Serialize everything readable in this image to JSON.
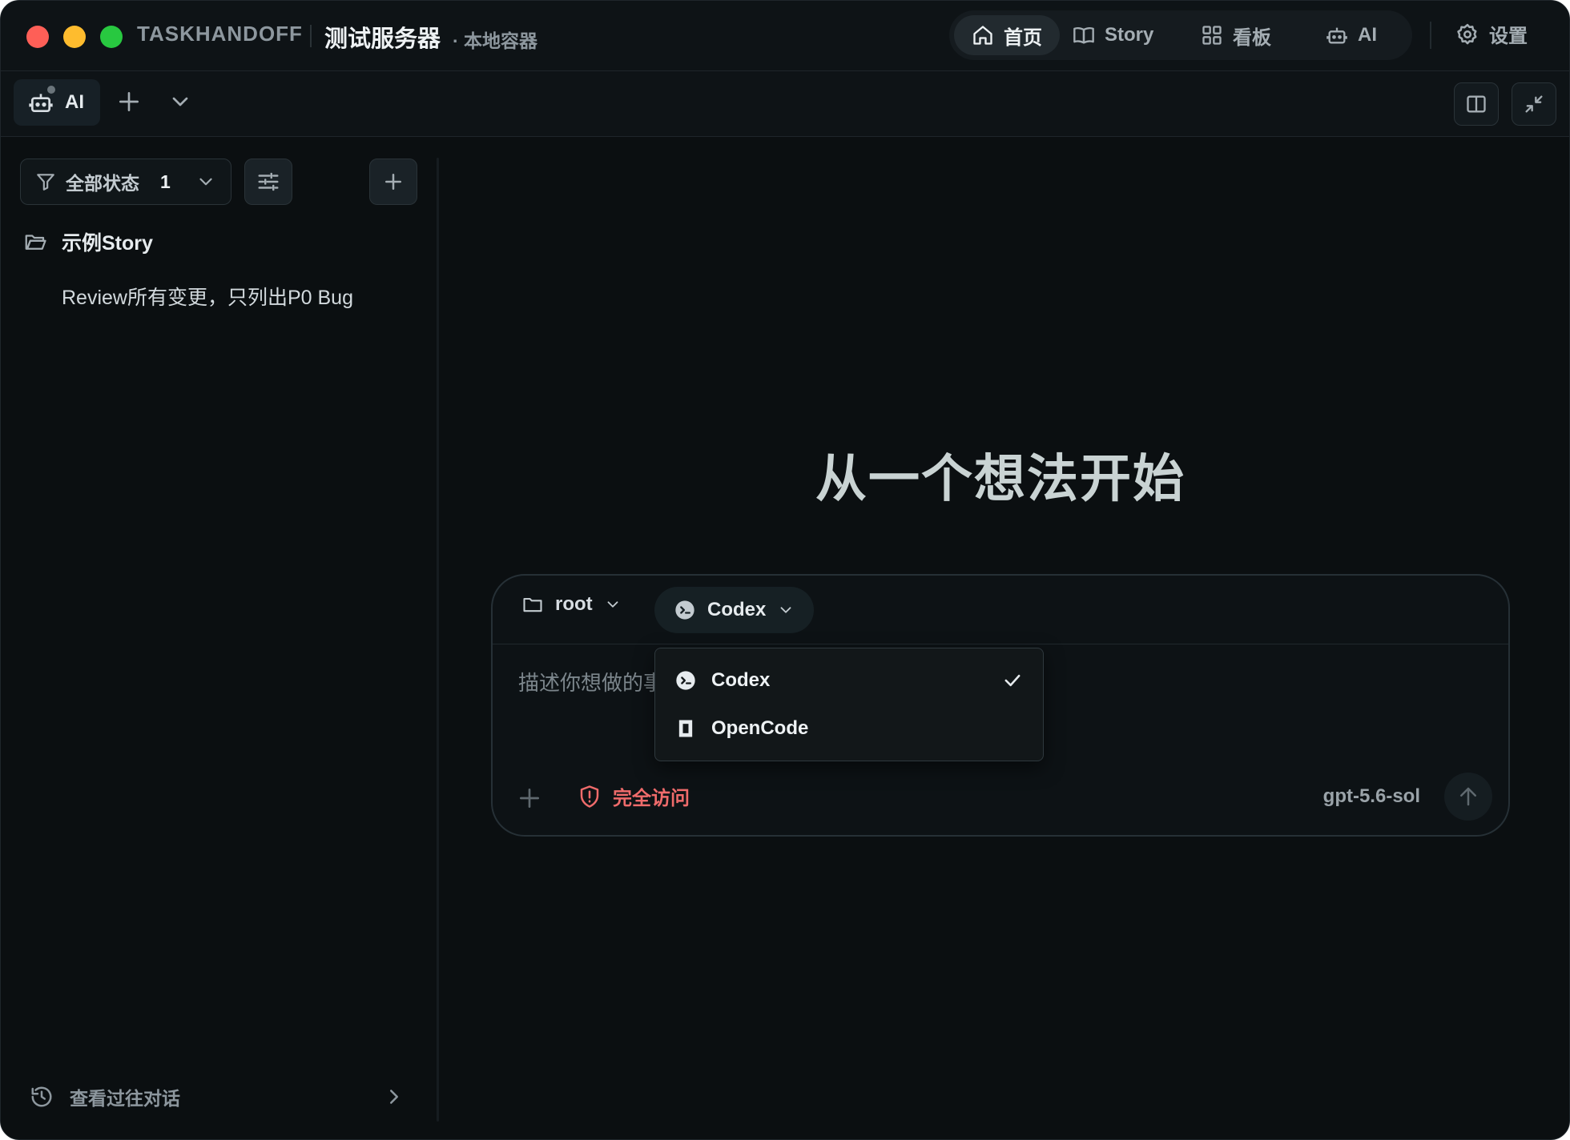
{
  "window": {
    "brand": "TASKHANDOFF",
    "server_name": "测试服务器",
    "server_sub": "· 本地容器"
  },
  "nav": {
    "items": [
      {
        "label": "首页",
        "icon": "home-icon",
        "active": true
      },
      {
        "label": "Story",
        "icon": "book-icon",
        "active": false
      },
      {
        "label": "看板",
        "icon": "grid-icon",
        "active": false
      },
      {
        "label": "AI",
        "icon": "robot-icon",
        "active": false
      }
    ],
    "settings_label": "设置"
  },
  "tabs": {
    "active_tab_label": "AI"
  },
  "sidebar": {
    "filter_label": "全部状态",
    "filter_count": "1",
    "story_group": "示例Story",
    "story_items": [
      "Review所有变更，只列出P0 Bug"
    ],
    "history_label": "查看过往对话"
  },
  "main": {
    "hero_title": "从一个想法开始",
    "composer": {
      "directory": "root",
      "agent": "Codex",
      "placeholder": "描述你想做的事",
      "access_label": "完全访问",
      "model": "gpt-5.6-sol"
    },
    "agent_dropdown": {
      "options": [
        {
          "label": "Codex",
          "selected": true
        },
        {
          "label": "OpenCode",
          "selected": false
        }
      ]
    }
  },
  "colors": {
    "background": "#0b0f11",
    "accent_danger": "#ef6b6b",
    "traffic_red": "#fe5f57",
    "traffic_yellow": "#febc2e",
    "traffic_green": "#28c840"
  }
}
